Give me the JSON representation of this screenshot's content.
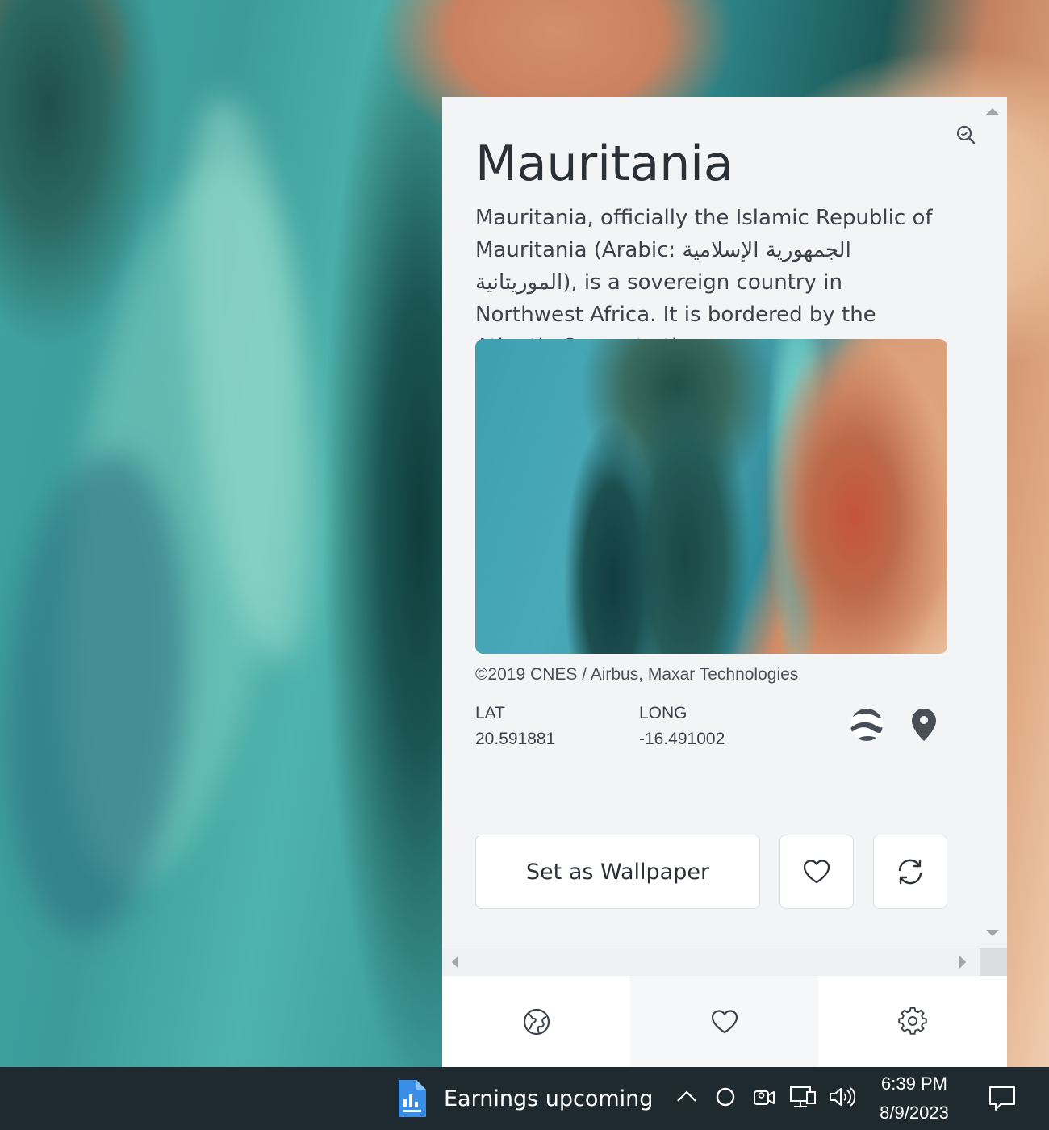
{
  "flyout": {
    "title": "Mauritania",
    "description": "Mauritania, officially the Islamic Republic of Mauritania (Arabic: الجمهورية الإسلامية الموريتانية), is a sovereign country in Northwest Africa. It is bordered by the Atlantic Ocean to the...",
    "image_credit": "©2019 CNES / Airbus, Maxar Technologies",
    "lat_label": "LAT",
    "lat_value": "20.591881",
    "long_label": "LONG",
    "long_value": "-16.491002",
    "set_wallpaper_label": "Set as Wallpaper",
    "icons": {
      "zoom": "zoom-icon",
      "earth": "google-earth-icon",
      "map_pin": "map-pin-icon",
      "favorite": "heart-icon",
      "refresh": "refresh-icon"
    }
  },
  "nav": {
    "items": [
      {
        "name": "explore",
        "icon": "globe-icon"
      },
      {
        "name": "favorites",
        "icon": "heart-icon"
      },
      {
        "name": "settings",
        "icon": "gear-icon"
      }
    ]
  },
  "taskbar": {
    "news_text": "Earnings upcoming",
    "time": "6:39 PM",
    "date": "8/9/2023",
    "tray_icons": [
      "chevron-up-icon",
      "cortana-icon",
      "meet-now-icon",
      "network-icon",
      "volume-icon"
    ],
    "notification_icon": "action-center-icon"
  },
  "colors": {
    "panel_bg": "#f3f4f6",
    "text_primary": "#2b2f36",
    "taskbar_bg": "#1f2a30",
    "icon_gray": "#4a4f57"
  }
}
